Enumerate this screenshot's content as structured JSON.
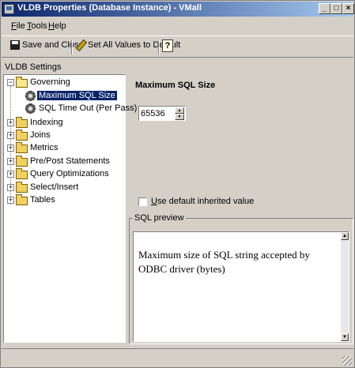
{
  "window": {
    "title": "VLDB Properties (Database Instance) - VMall",
    "minimize": "_",
    "maximize": "□",
    "close": "×"
  },
  "menu": [
    {
      "label": "ile",
      "accel": "F"
    },
    {
      "label": "ools",
      "accel": "T"
    },
    {
      "label": "elp",
      "accel": "H"
    }
  ],
  "toolbar": {
    "save_close": "Save and Close",
    "set_default": "Set All Values to Default",
    "help_icon": "?"
  },
  "settings_label": "VLDB Settings",
  "tree": {
    "governing": "Governing",
    "max_sql_size": "Maximum SQL Size",
    "sql_timeout": "SQL Time Out (Per Pass)",
    "indexing": "Indexing",
    "joins": "Joins",
    "metrics": "Metrics",
    "pre_post": "Pre/Post Statements",
    "query_opt": "Query Optimizations",
    "select_insert": "Select/Insert",
    "tables": "Tables"
  },
  "detail": {
    "title": "Maximum SQL Size",
    "value": "65536",
    "checkbox_accel": "U",
    "checkbox_label": "se default inherited value"
  },
  "preview": {
    "legend": "SQL preview",
    "text": "Maximum size of SQL string accepted by ODBC driver (bytes)"
  }
}
